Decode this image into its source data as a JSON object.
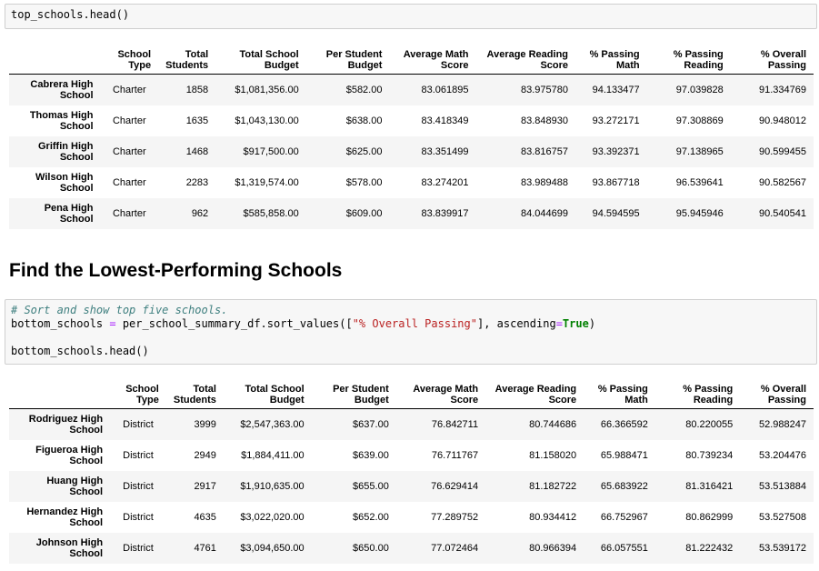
{
  "cell1": {
    "line": "top_schools.head()"
  },
  "columns": [
    "School\nType",
    "Total\nStudents",
    "Total School\nBudget",
    "Per Student\nBudget",
    "Average Math\nScore",
    "Average Reading\nScore",
    "% Passing\nMath",
    "% Passing\nReading",
    "% Overall\nPassing"
  ],
  "top_rows": [
    {
      "name": "Cabrera High\nSchool",
      "type": "Charter",
      "students": "1858",
      "budget": "$1,081,356.00",
      "per": "$582.00",
      "math": "83.061895",
      "reading": "83.975780",
      "pmath": "94.133477",
      "pread": "97.039828",
      "overall": "91.334769"
    },
    {
      "name": "Thomas High\nSchool",
      "type": "Charter",
      "students": "1635",
      "budget": "$1,043,130.00",
      "per": "$638.00",
      "math": "83.418349",
      "reading": "83.848930",
      "pmath": "93.272171",
      "pread": "97.308869",
      "overall": "90.948012"
    },
    {
      "name": "Griffin High\nSchool",
      "type": "Charter",
      "students": "1468",
      "budget": "$917,500.00",
      "per": "$625.00",
      "math": "83.351499",
      "reading": "83.816757",
      "pmath": "93.392371",
      "pread": "97.138965",
      "overall": "90.599455"
    },
    {
      "name": "Wilson High\nSchool",
      "type": "Charter",
      "students": "2283",
      "budget": "$1,319,574.00",
      "per": "$578.00",
      "math": "83.274201",
      "reading": "83.989488",
      "pmath": "93.867718",
      "pread": "96.539641",
      "overall": "90.582567"
    },
    {
      "name": "Pena High\nSchool",
      "type": "Charter",
      "students": "962",
      "budget": "$585,858.00",
      "per": "$609.00",
      "math": "83.839917",
      "reading": "84.044699",
      "pmath": "94.594595",
      "pread": "95.945946",
      "overall": "90.540541"
    }
  ],
  "section_title": "Find the Lowest-Performing Schools",
  "cell2": {
    "comment": "# Sort and show top five schools.",
    "l2_a": "bottom_schools ",
    "l2_eq": "=",
    "l2_b": " per_school_summary_df.sort_values([",
    "l2_str": "\"% Overall Passing\"",
    "l2_c": "], ascending",
    "l2_eq2": "=",
    "l2_kw": "True",
    "l2_d": ")",
    "l4": "bottom_schools.head()"
  },
  "bottom_rows": [
    {
      "name": "Rodriguez High\nSchool",
      "type": "District",
      "students": "3999",
      "budget": "$2,547,363.00",
      "per": "$637.00",
      "math": "76.842711",
      "reading": "80.744686",
      "pmath": "66.366592",
      "pread": "80.220055",
      "overall": "52.988247"
    },
    {
      "name": "Figueroa High\nSchool",
      "type": "District",
      "students": "2949",
      "budget": "$1,884,411.00",
      "per": "$639.00",
      "math": "76.711767",
      "reading": "81.158020",
      "pmath": "65.988471",
      "pread": "80.739234",
      "overall": "53.204476"
    },
    {
      "name": "Huang High\nSchool",
      "type": "District",
      "students": "2917",
      "budget": "$1,910,635.00",
      "per": "$655.00",
      "math": "76.629414",
      "reading": "81.182722",
      "pmath": "65.683922",
      "pread": "81.316421",
      "overall": "53.513884"
    },
    {
      "name": "Hernandez High\nSchool",
      "type": "District",
      "students": "4635",
      "budget": "$3,022,020.00",
      "per": "$652.00",
      "math": "77.289752",
      "reading": "80.934412",
      "pmath": "66.752967",
      "pread": "80.862999",
      "overall": "53.527508"
    },
    {
      "name": "Johnson High\nSchool",
      "type": "District",
      "students": "4761",
      "budget": "$3,094,650.00",
      "per": "$650.00",
      "math": "77.072464",
      "reading": "80.966394",
      "pmath": "66.057551",
      "pread": "81.222432",
      "overall": "53.539172"
    }
  ]
}
